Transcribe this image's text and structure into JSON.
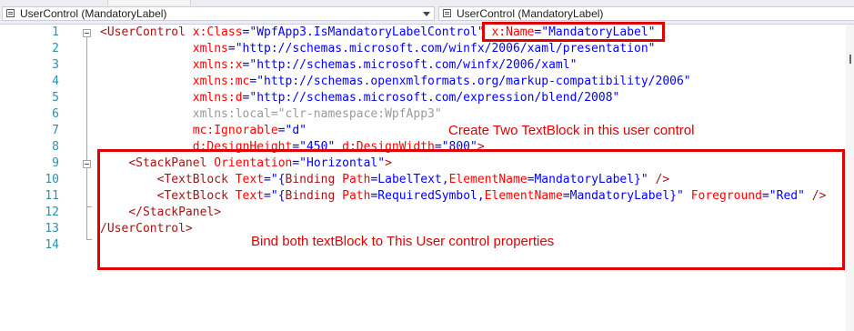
{
  "navbar": {
    "left_dropdown": "UserControl (MandatoryLabel)",
    "right_dropdown": "UserControl (MandatoryLabel)"
  },
  "editor": {
    "line_numbers": [
      "1",
      "2",
      "3",
      "4",
      "5",
      "6",
      "7",
      "8",
      "9",
      "10",
      "11",
      "12",
      "13",
      "14"
    ],
    "lines": [
      [
        {
          "t": "<",
          "c": "c-br"
        },
        {
          "t": "UserControl",
          "c": "c-el"
        },
        {
          "t": " "
        },
        {
          "t": "x:Class",
          "c": "c-at"
        },
        {
          "t": "=\"WpfApp3.IsMandatoryLabelControl\"",
          "c": "c-val"
        },
        {
          "t": " "
        },
        {
          "t": "x:Name",
          "c": "c-at"
        },
        {
          "t": "=\"MandatoryLabel\"",
          "c": "c-val"
        }
      ],
      [
        {
          "t": "             "
        },
        {
          "t": "xmlns",
          "c": "c-at"
        },
        {
          "t": "=\"http://schemas.microsoft.com/winfx/2006/xaml/presentation\"",
          "c": "c-val"
        }
      ],
      [
        {
          "t": "             "
        },
        {
          "t": "xmlns:x",
          "c": "c-at"
        },
        {
          "t": "=\"http://schemas.microsoft.com/winfx/2006/xaml\"",
          "c": "c-val"
        }
      ],
      [
        {
          "t": "             "
        },
        {
          "t": "xmlns:mc",
          "c": "c-at"
        },
        {
          "t": "=\"http://schemas.openxmlformats.org/markup-compatibility/2006\"",
          "c": "c-val"
        }
      ],
      [
        {
          "t": "             "
        },
        {
          "t": "xmlns:d",
          "c": "c-at"
        },
        {
          "t": "=\"http://schemas.microsoft.com/expression/blend/2008\"",
          "c": "c-val"
        }
      ],
      [
        {
          "t": "             "
        },
        {
          "t": "xmlns:local=\"clr-namespace:WpfApp3\"",
          "c": "c-dim"
        }
      ],
      [
        {
          "t": "             "
        },
        {
          "t": "mc:Ignorable",
          "c": "c-at"
        },
        {
          "t": "=\"d\"",
          "c": "c-val"
        }
      ],
      [
        {
          "t": "             "
        },
        {
          "t": "d:DesignHeight",
          "c": "c-at"
        },
        {
          "t": "=\"450\"",
          "c": "c-val"
        },
        {
          "t": " "
        },
        {
          "t": "d:DesignWidth",
          "c": "c-at"
        },
        {
          "t": "=\"800\"",
          "c": "c-val"
        },
        {
          "t": ">",
          "c": "c-br"
        }
      ],
      [
        {
          "t": "    "
        },
        {
          "t": "<",
          "c": "c-br"
        },
        {
          "t": "StackPanel",
          "c": "c-el"
        },
        {
          "t": " "
        },
        {
          "t": "Orientation",
          "c": "c-at"
        },
        {
          "t": "=\"Horizontal\"",
          "c": "c-val"
        },
        {
          "t": ">",
          "c": "c-br"
        }
      ],
      [
        {
          "t": "        "
        },
        {
          "t": "<",
          "c": "c-br"
        },
        {
          "t": "TextBlock",
          "c": "c-el"
        },
        {
          "t": " "
        },
        {
          "t": "Text",
          "c": "c-at"
        },
        {
          "t": "=\"{",
          "c": "c-val"
        },
        {
          "t": "Binding",
          "c": "c-el"
        },
        {
          "t": " "
        },
        {
          "t": "Path",
          "c": "c-at"
        },
        {
          "t": "=LabelText,",
          "c": "c-val"
        },
        {
          "t": "ElementName",
          "c": "c-at"
        },
        {
          "t": "=MandatoryLabel}\"",
          "c": "c-val"
        },
        {
          "t": " "
        },
        {
          "t": "/>",
          "c": "c-br"
        }
      ],
      [
        {
          "t": "        "
        },
        {
          "t": "<",
          "c": "c-br"
        },
        {
          "t": "TextBlock",
          "c": "c-el"
        },
        {
          "t": " "
        },
        {
          "t": "Text",
          "c": "c-at"
        },
        {
          "t": "=\"{",
          "c": "c-val"
        },
        {
          "t": "Binding",
          "c": "c-el"
        },
        {
          "t": " "
        },
        {
          "t": "Path",
          "c": "c-at"
        },
        {
          "t": "=RequiredSymbol,",
          "c": "c-val"
        },
        {
          "t": "ElementName",
          "c": "c-at"
        },
        {
          "t": "=MandatoryLabel}\"",
          "c": "c-val"
        },
        {
          "t": " "
        },
        {
          "t": "Foreground",
          "c": "c-at"
        },
        {
          "t": "=\"Red\"",
          "c": "c-val"
        },
        {
          "t": " "
        },
        {
          "t": "/>",
          "c": "c-br"
        }
      ],
      [
        {
          "t": "    "
        },
        {
          "t": "</",
          "c": "c-br"
        },
        {
          "t": "StackPanel",
          "c": "c-el"
        },
        {
          "t": ">",
          "c": "c-br"
        }
      ],
      [
        {
          "t": "/",
          "c": "c-br"
        },
        {
          "t": "UserControl",
          "c": "c-el"
        },
        {
          "t": ">",
          "c": "c-br"
        }
      ],
      []
    ]
  },
  "annotations": {
    "top": "Create Two TextBlock in this user control",
    "bottom": "Bind both textBlock to This User control properties"
  }
}
